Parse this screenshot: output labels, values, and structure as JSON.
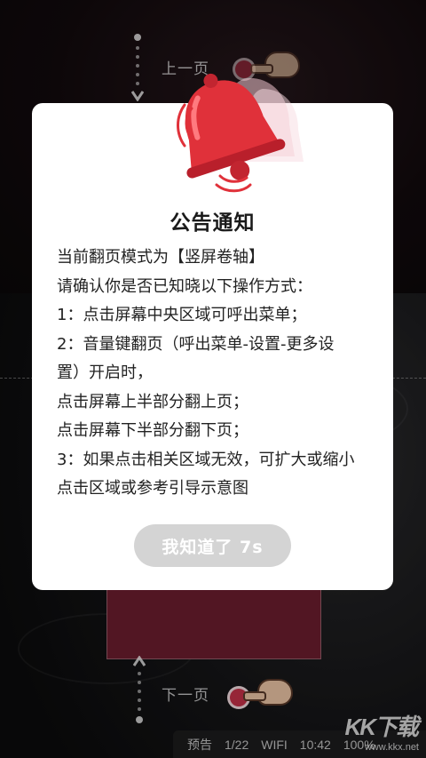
{
  "reader": {
    "prev_page_hint": "上一页",
    "next_page_hint": "下一页"
  },
  "status_bar": {
    "mode": "预告",
    "page": "1/22",
    "network": "WIFI",
    "time": "10:42",
    "battery": "100%"
  },
  "watermark": {
    "logo": "KK下载",
    "url": "www.kkx.net"
  },
  "dialog": {
    "icon": "bell-icon",
    "title": "公告通知",
    "lines": [
      "当前翻页模式为【竖屏卷轴】",
      "请确认你是否已知晓以下操作方式：",
      "1：点击屏幕中央区域可呼出菜单；",
      "2：音量键翻页（呼出菜单-设置-更多设",
      "置）开启时，",
      "点击屏幕上半部分翻上页；",
      "点击屏幕下半部分翻下页；",
      "3：如果点击相关区域无效，可扩大或缩小",
      "点击区域或参考引导示意图"
    ],
    "ack_button": "我知道了 7s"
  },
  "colors": {
    "accent_red": "#e0313a",
    "button_disabled": "#d4d4d4",
    "center_zone": "#6e1e2f"
  }
}
